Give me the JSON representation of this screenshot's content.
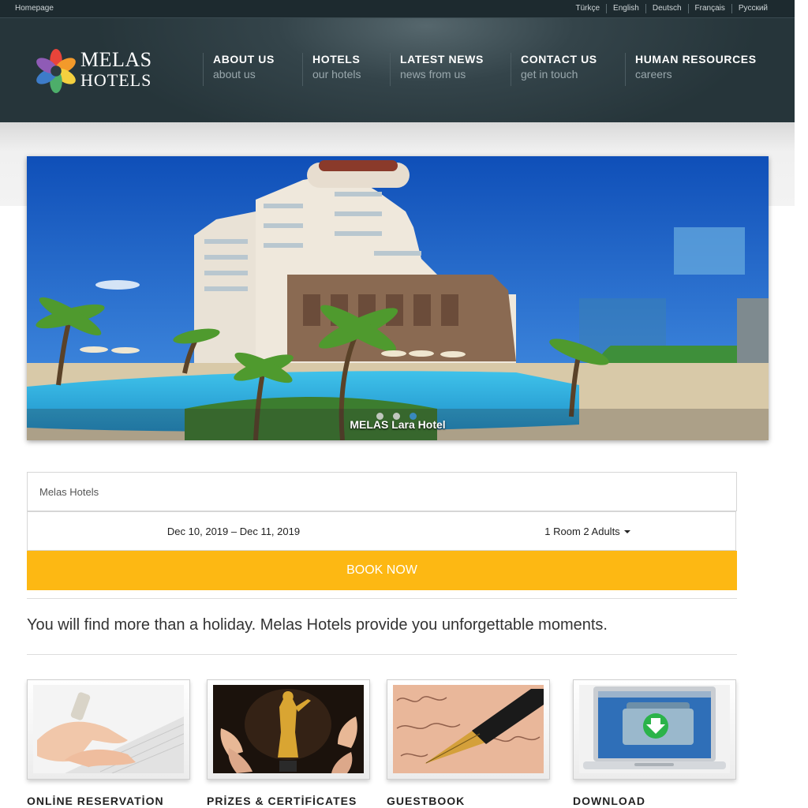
{
  "topbar": {
    "home": "Homepage",
    "languages": [
      "Türkçe",
      "English",
      "Deutsch",
      "Français",
      "Русский"
    ]
  },
  "logo": {
    "line1": "MELAS",
    "line2": "HOTELS"
  },
  "nav": [
    {
      "title": "ABOUT US",
      "sub": "about us"
    },
    {
      "title": "HOTELS",
      "sub": "our hotels"
    },
    {
      "title": "LATEST NEWS",
      "sub": "news from us"
    },
    {
      "title": "CONTACT US",
      "sub": "get in touch"
    },
    {
      "title": "HUMAN RESOURCES",
      "sub": "careers"
    }
  ],
  "slider": {
    "caption": "MELAS Lara Hotel",
    "slide_count": 3,
    "active_slide": 3
  },
  "booking": {
    "hotel": "Melas Hotels",
    "dates": "Dec 10, 2019 – Dec 11, 2019",
    "guests": "1 Room 2 Adults",
    "button": "BOOK NOW"
  },
  "tagline": "You will find more than a holiday. Melas Hotels provide you unforgettable moments.",
  "features": [
    {
      "label": "ONLİNE RESERVATİON",
      "icon": "typing-hands-image"
    },
    {
      "label": "PRİZES & CERTİFİCATES",
      "icon": "award-statue-image"
    },
    {
      "label": "GUESTBOOK",
      "icon": "fountain-pen-image"
    },
    {
      "label": "DOWNLOAD",
      "icon": "laptop-download-image"
    }
  ],
  "colors": {
    "accent": "#fdb813",
    "header": "#2c3b41",
    "topbar": "#1d2a2f"
  }
}
